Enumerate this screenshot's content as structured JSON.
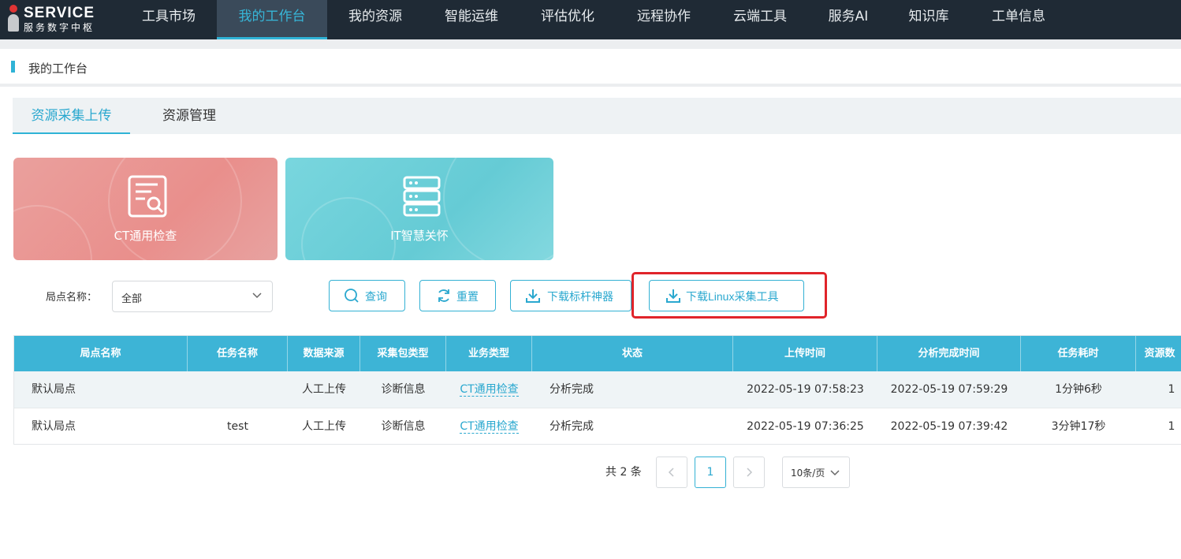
{
  "logo": {
    "brand": "SERVICE",
    "subtitle": "服务数字中枢"
  },
  "nav": {
    "items": [
      "工具市场",
      "我的工作台",
      "我的资源",
      "智能运维",
      "评估优化",
      "远程协作",
      "云端工具",
      "服务AI",
      "知识库",
      "工单信息"
    ],
    "active_index": 1
  },
  "breadcrumb": {
    "title": "我的工作台"
  },
  "tabs": {
    "items": [
      "资源采集上传",
      "资源管理"
    ],
    "active_index": 0
  },
  "cards": [
    {
      "label": "CT通用检查",
      "icon": "document-search-icon",
      "color": "#e99592"
    },
    {
      "label": "IT智慧关怀",
      "icon": "server-icon",
      "color": "#6fd0d9"
    }
  ],
  "filter": {
    "label": "局点名称：",
    "select_value": "全部"
  },
  "buttons": {
    "query": "查询",
    "reset": "重置",
    "download_tool": "下载标杆神器",
    "download_linux": "下载Linux采集工具"
  },
  "table": {
    "headers": [
      "局点名称",
      "任务名称",
      "数据来源",
      "采集包类型",
      "业务类型",
      "状态",
      "上传时间",
      "分析完成时间",
      "任务耗时",
      "资源数"
    ],
    "rows": [
      [
        "默认局点",
        "",
        "人工上传",
        "诊断信息",
        "CT通用检查",
        "分析完成",
        "2022-05-19 07:58:23",
        "2022-05-19 07:59:29",
        "1分钟6秒",
        "1"
      ],
      [
        "默认局点",
        "test",
        "人工上传",
        "诊断信息",
        "CT通用检查",
        "分析完成",
        "2022-05-19 07:36:25",
        "2022-05-19 07:39:42",
        "3分钟17秒",
        "1"
      ]
    ]
  },
  "pagination": {
    "total_text": "共 2 条",
    "current_page": "1",
    "page_size": "10条/页"
  },
  "colors": {
    "accent": "#2fb3d6",
    "nav_bg": "#1f2a35",
    "highlight": "#e0242a"
  }
}
